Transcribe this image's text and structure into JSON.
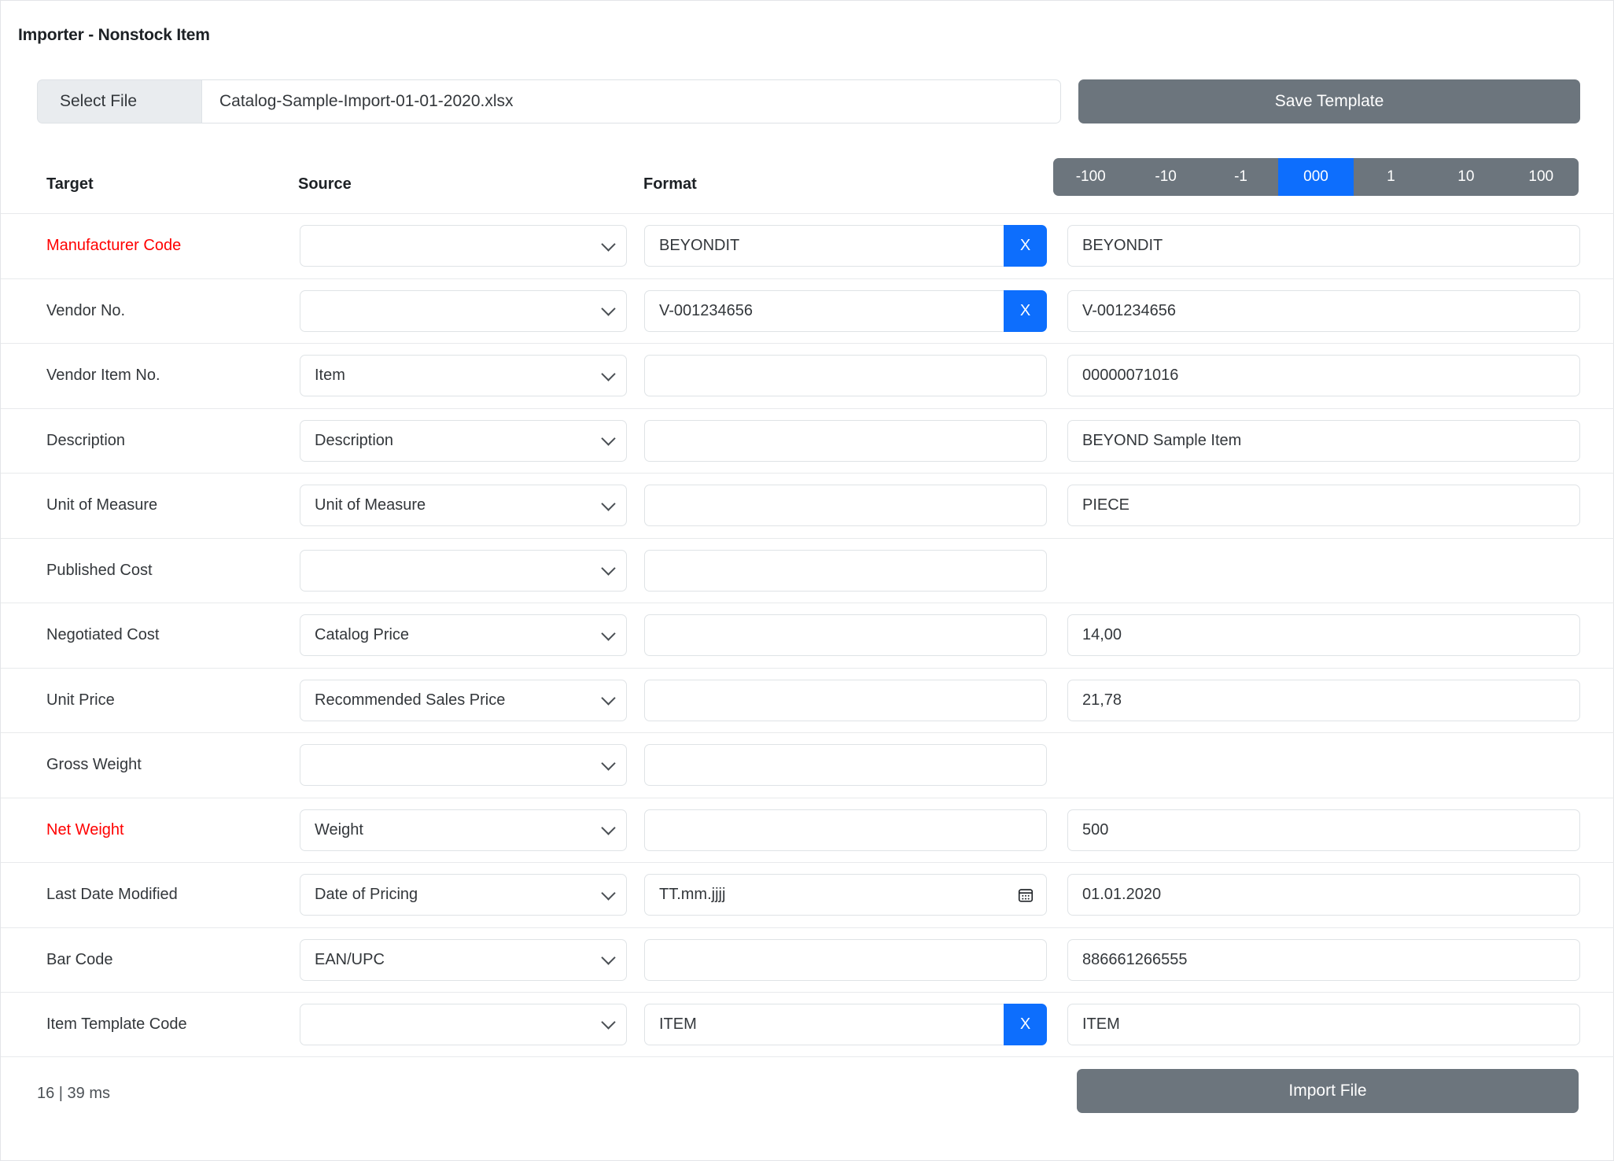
{
  "app": {
    "title": "Importer - Nonstock Item"
  },
  "file_bar": {
    "select_file_label": "Select File",
    "file_name": "Catalog-Sample-Import-01-01-2020.xlsx",
    "save_template_label": "Save Template"
  },
  "stepper": {
    "buttons": [
      "-100",
      "-10",
      "-1",
      "000",
      "1",
      "10",
      "100"
    ],
    "active_index": 3,
    "active_color": "#0d6efd",
    "base_color": "#6c757d"
  },
  "columns": {
    "target": "Target",
    "source": "Source",
    "format": "Format"
  },
  "colors": {
    "required_label": "#ff0000",
    "accent_blue": "#0d6efd",
    "button_gray": "#6c757d",
    "prepend_gray": "#e9ecef"
  },
  "rows": [
    {
      "target": "Manufacturer Code",
      "required": true,
      "source": "",
      "format": "BEYONDIT",
      "has_clear": true,
      "has_calendar": false,
      "value": "BEYONDIT",
      "has_value": true
    },
    {
      "target": "Vendor No.",
      "required": false,
      "source": "",
      "format": "V-001234656",
      "has_clear": true,
      "has_calendar": false,
      "value": "V-001234656",
      "has_value": true
    },
    {
      "target": "Vendor Item No.",
      "required": false,
      "source": "Item",
      "format": "",
      "has_clear": false,
      "has_calendar": false,
      "value": "00000071016",
      "has_value": true
    },
    {
      "target": "Description",
      "required": false,
      "source": "Description",
      "format": "",
      "has_clear": false,
      "has_calendar": false,
      "value": "BEYOND Sample Item",
      "has_value": true
    },
    {
      "target": "Unit of Measure",
      "required": false,
      "source": "Unit of Measure",
      "format": "",
      "has_clear": false,
      "has_calendar": false,
      "value": "PIECE",
      "has_value": true
    },
    {
      "target": "Published Cost",
      "required": false,
      "source": "",
      "format": "",
      "has_clear": false,
      "has_calendar": false,
      "value": "",
      "has_value": false
    },
    {
      "target": "Negotiated Cost",
      "required": false,
      "source": "Catalog Price",
      "format": "",
      "has_clear": false,
      "has_calendar": false,
      "value": "14,00",
      "has_value": true
    },
    {
      "target": "Unit Price",
      "required": false,
      "source": "Recommended Sales Price",
      "format": "",
      "has_clear": false,
      "has_calendar": false,
      "value": "21,78",
      "has_value": true
    },
    {
      "target": "Gross Weight",
      "required": false,
      "source": "",
      "format": "",
      "has_clear": false,
      "has_calendar": false,
      "value": "",
      "has_value": false
    },
    {
      "target": "Net Weight",
      "required": true,
      "source": "Weight",
      "format": "",
      "has_clear": false,
      "has_calendar": false,
      "value": "500",
      "has_value": true
    },
    {
      "target": "Last Date Modified",
      "required": false,
      "source": "Date of Pricing",
      "format": "TT.mm.jjjj",
      "has_clear": false,
      "has_calendar": true,
      "value": "01.01.2020",
      "has_value": true
    },
    {
      "target": "Bar Code",
      "required": false,
      "source": "EAN/UPC",
      "format": "",
      "has_clear": false,
      "has_calendar": false,
      "value": "886661266555",
      "has_value": true
    },
    {
      "target": "Item Template Code",
      "required": false,
      "source": "",
      "format": "ITEM",
      "has_clear": true,
      "has_calendar": false,
      "value": "ITEM",
      "has_value": true
    }
  ],
  "clear_button_label": "X",
  "footer": {
    "status": "16 | 39 ms",
    "import_label": "Import File"
  }
}
